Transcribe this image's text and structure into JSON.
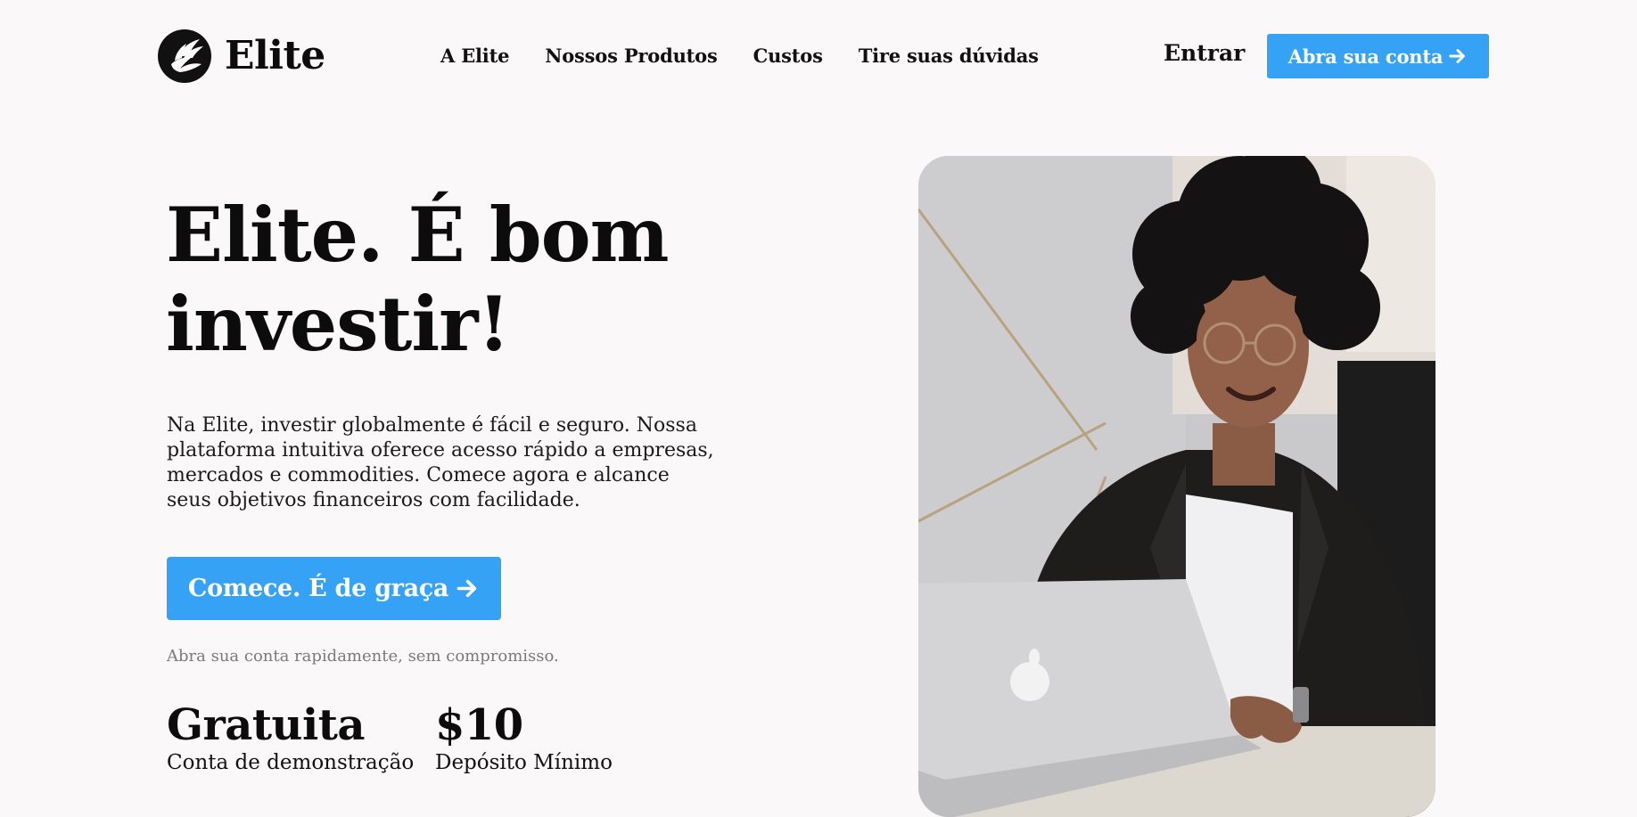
{
  "brand": {
    "name": "Elite"
  },
  "nav": {
    "items": [
      {
        "label": "A Elite"
      },
      {
        "label": "Nossos Produtos"
      },
      {
        "label": "Custos"
      },
      {
        "label": "Tire suas dúvidas"
      }
    ]
  },
  "header": {
    "login_label": "Entrar",
    "open_account_label": "Abra sua conta"
  },
  "hero": {
    "title_line1": "Elite. É bom",
    "title_line2": "investir!",
    "description": "Na Elite, investir globalmente é fácil e seguro. Nossa plataforma intuitiva oferece acesso rápido a empresas, mercados e commodities. Comece agora e alcance seus objetivos financeiros com facilidade.",
    "cta_label": "Comece. É de graça",
    "cta_note": "Abra sua conta rapidamente, sem compromisso."
  },
  "stats": [
    {
      "value": "Gratuita",
      "label": "Conta de demonstração"
    },
    {
      "value": "$10",
      "label": "Depósito Mínimo"
    }
  ],
  "icons": {
    "logo": "bird-logo-icon",
    "arrow": "arrow-right-icon"
  },
  "colors": {
    "accent": "#36a2f5",
    "background": "#faf8f9",
    "text": "#0c0c0c",
    "muted": "#7a7a7a"
  }
}
